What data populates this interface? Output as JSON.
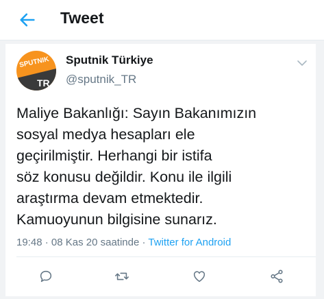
{
  "header": {
    "title": "Tweet",
    "back_icon": "arrow-left-icon"
  },
  "tweet": {
    "avatar": {
      "logo_text": "SPUTNIK",
      "logo_short": "TR",
      "colors": {
        "orange": "#f7931e",
        "dark": "#3a3a3a"
      }
    },
    "display_name": "Sputnik Türkiye",
    "username": "@sputnik_TR",
    "text_lines": [
      "Maliye Bakanlığı: Sayın Bakanımızın",
      "sosyal medya hesapları ele",
      "geçirilmiştir. Herhangi bir istifa",
      "söz konusu değildir. Konu ile ilgili",
      "araştırma devam etmektedir.",
      "Kamuoyunun bilgisine sunarız."
    ],
    "time": "19:48",
    "date": "08 Kas 20 saatinde",
    "separator": "·",
    "source": "Twitter for Android",
    "actions": [
      "reply-icon",
      "retweet-icon",
      "like-icon",
      "share-icon"
    ]
  },
  "colors": {
    "accent": "#1da1f2",
    "text": "#14171a",
    "muted": "#657786"
  }
}
